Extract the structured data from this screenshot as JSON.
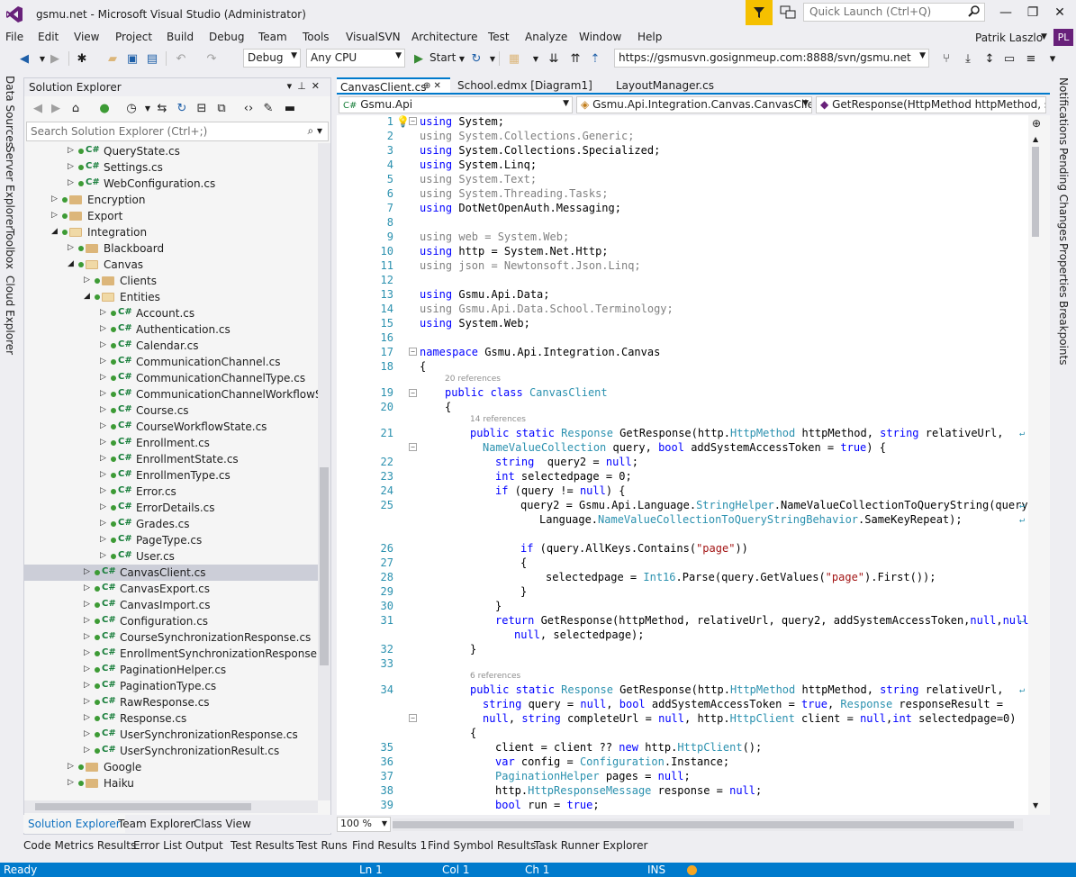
{
  "window": {
    "title": "gsmu.net - Microsoft Visual Studio (Administrator)",
    "quick_launch_placeholder": "Quick Launch (Ctrl+Q)",
    "user_name": "Patrik Laszlo",
    "user_initials": "PL"
  },
  "menu": [
    "File",
    "Edit",
    "View",
    "Project",
    "Build",
    "Debug",
    "Team",
    "Tools",
    "VisualSVN",
    "Architecture",
    "Test",
    "Analyze",
    "Window",
    "Help"
  ],
  "toolbar": {
    "config": "Debug",
    "platform": "Any CPU",
    "start_label": "Start",
    "svn_url": "https://gsmusvn.gosignmeup.com:8888/svn/gsmu.net"
  },
  "left_vtabs": [
    "Data Sources",
    "Server Explorer",
    "Toolbox",
    "Cloud Explorer"
  ],
  "right_vtabs": [
    "Notifications",
    "Pending Changes",
    "Properties",
    "Breakpoints"
  ],
  "solution_explorer": {
    "title": "Solution Explorer",
    "search_placeholder": "Search Solution Explorer (Ctrl+;)",
    "tree": [
      {
        "label": "QueryState.cs",
        "indent": 3,
        "kind": "cs"
      },
      {
        "label": "Settings.cs",
        "indent": 3,
        "kind": "cs"
      },
      {
        "label": "WebConfiguration.cs",
        "indent": 3,
        "kind": "cs"
      },
      {
        "label": "Encryption",
        "indent": 2,
        "kind": "folder"
      },
      {
        "label": "Export",
        "indent": 2,
        "kind": "folder"
      },
      {
        "label": "Integration",
        "indent": 2,
        "kind": "folder-open"
      },
      {
        "label": "Blackboard",
        "indent": 3,
        "kind": "folder"
      },
      {
        "label": "Canvas",
        "indent": 3,
        "kind": "folder-open"
      },
      {
        "label": "Clients",
        "indent": 4,
        "kind": "folder"
      },
      {
        "label": "Entities",
        "indent": 4,
        "kind": "folder-open"
      },
      {
        "label": "Account.cs",
        "indent": 5,
        "kind": "cs"
      },
      {
        "label": "Authentication.cs",
        "indent": 5,
        "kind": "cs"
      },
      {
        "label": "Calendar.cs",
        "indent": 5,
        "kind": "cs"
      },
      {
        "label": "CommunicationChannel.cs",
        "indent": 5,
        "kind": "cs"
      },
      {
        "label": "CommunicationChannelType.cs",
        "indent": 5,
        "kind": "cs"
      },
      {
        "label": "CommunicationChannelWorkflowStat",
        "indent": 5,
        "kind": "cs"
      },
      {
        "label": "Course.cs",
        "indent": 5,
        "kind": "cs"
      },
      {
        "label": "CourseWorkflowState.cs",
        "indent": 5,
        "kind": "cs"
      },
      {
        "label": "Enrollment.cs",
        "indent": 5,
        "kind": "cs"
      },
      {
        "label": "EnrollmentState.cs",
        "indent": 5,
        "kind": "cs"
      },
      {
        "label": "EnrollmenType.cs",
        "indent": 5,
        "kind": "cs"
      },
      {
        "label": "Error.cs",
        "indent": 5,
        "kind": "cs"
      },
      {
        "label": "ErrorDetails.cs",
        "indent": 5,
        "kind": "cs"
      },
      {
        "label": "Grades.cs",
        "indent": 5,
        "kind": "cs"
      },
      {
        "label": "PageType.cs",
        "indent": 5,
        "kind": "cs"
      },
      {
        "label": "User.cs",
        "indent": 5,
        "kind": "cs"
      },
      {
        "label": "CanvasClient.cs",
        "indent": 4,
        "kind": "cs",
        "selected": true
      },
      {
        "label": "CanvasExport.cs",
        "indent": 4,
        "kind": "cs"
      },
      {
        "label": "CanvasImport.cs",
        "indent": 4,
        "kind": "cs"
      },
      {
        "label": "Configuration.cs",
        "indent": 4,
        "kind": "cs"
      },
      {
        "label": "CourseSynchronizationResponse.cs",
        "indent": 4,
        "kind": "cs"
      },
      {
        "label": "EnrollmentSynchronizationResponse.cs",
        "indent": 4,
        "kind": "cs"
      },
      {
        "label": "PaginationHelper.cs",
        "indent": 4,
        "kind": "cs"
      },
      {
        "label": "PaginationType.cs",
        "indent": 4,
        "kind": "cs"
      },
      {
        "label": "RawResponse.cs",
        "indent": 4,
        "kind": "cs"
      },
      {
        "label": "Response.cs",
        "indent": 4,
        "kind": "cs"
      },
      {
        "label": "UserSynchronizationResponse.cs",
        "indent": 4,
        "kind": "cs"
      },
      {
        "label": "UserSynchronizationResult.cs",
        "indent": 4,
        "kind": "cs"
      },
      {
        "label": "Google",
        "indent": 3,
        "kind": "folder"
      },
      {
        "label": "Haiku",
        "indent": 3,
        "kind": "folder"
      }
    ],
    "tabs": [
      "Solution Explorer",
      "Team Explorer",
      "Class View"
    ]
  },
  "editor": {
    "tabs": [
      {
        "label": "CanvasClient.cs",
        "pin": "⊕ ✕",
        "active": true
      },
      {
        "label": "School.edmx [Diagram1]",
        "active": false
      },
      {
        "label": "LayoutManager.cs",
        "active": false
      }
    ],
    "nav_project": "Gsmu.Api",
    "nav_class": "Gsmu.Api.Integration.Canvas.CanvasClient",
    "nav_member": "GetResponse(HttpMethod httpMethod, str",
    "zoom": "100 %",
    "line_numbers": [
      "1",
      "2",
      "3",
      "4",
      "5",
      "6",
      "7",
      "8",
      "9",
      "10",
      "11",
      "12",
      "13",
      "14",
      "15",
      "16",
      "17",
      "18",
      "19",
      "20",
      "21",
      "22",
      "23",
      "24",
      "25",
      "26",
      "27",
      "28",
      "29",
      "30",
      "31",
      "32",
      "33",
      "34",
      "35",
      "36",
      "37",
      "38",
      "39",
      "40"
    ],
    "refs": [
      "20 references",
      "14 references",
      "6 references"
    ],
    "code": {
      "l1": "System;",
      "l2": "System.Collections.Generic;",
      "l3": "System.Collections.Specialized;",
      "l4": "System.Linq;",
      "l5": "System.Text;",
      "l6": "System.Threading.Tasks;",
      "l7": "DotNetOpenAuth.Messaging;",
      "l9": "web = System.Web;",
      "l10": "http = System.Net.Http;",
      "l11": "json = Newtonsoft.Json.Linq;",
      "l13": "Gsmu.Api.Data;",
      "l14": "Gsmu.Api.Data.School.Terminology;",
      "l15": "System.Web;",
      "l17": "Gsmu.Api.Integration.Canvas"
    }
  },
  "bottom_tabs": [
    "Code Metrics Results",
    "Error List",
    "Output",
    "Test Results",
    "Test Runs",
    "Find Results 1",
    "Find Symbol Results",
    "Task Runner Explorer"
  ],
  "status": {
    "ready": "Ready",
    "ln": "Ln 1",
    "col": "Col 1",
    "ch": "Ch 1",
    "ins": "INS"
  }
}
